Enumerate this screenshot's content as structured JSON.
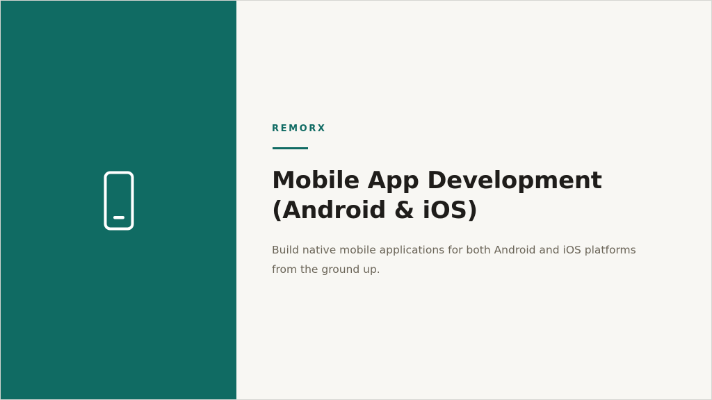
{
  "slide": {
    "icon": "mobile-phone-icon",
    "brand": "REMORX",
    "title_line1": "Mobile App Development",
    "title_line2": "(Android & iOS)",
    "description_line1": "Build native mobile applications for both Android and iOS platforms",
    "description_line2": "from the ground up."
  },
  "colors": {
    "accent": "#106b63",
    "background": "#f8f7f3",
    "title": "#1f1d1a",
    "body_text": "#6b6558"
  }
}
